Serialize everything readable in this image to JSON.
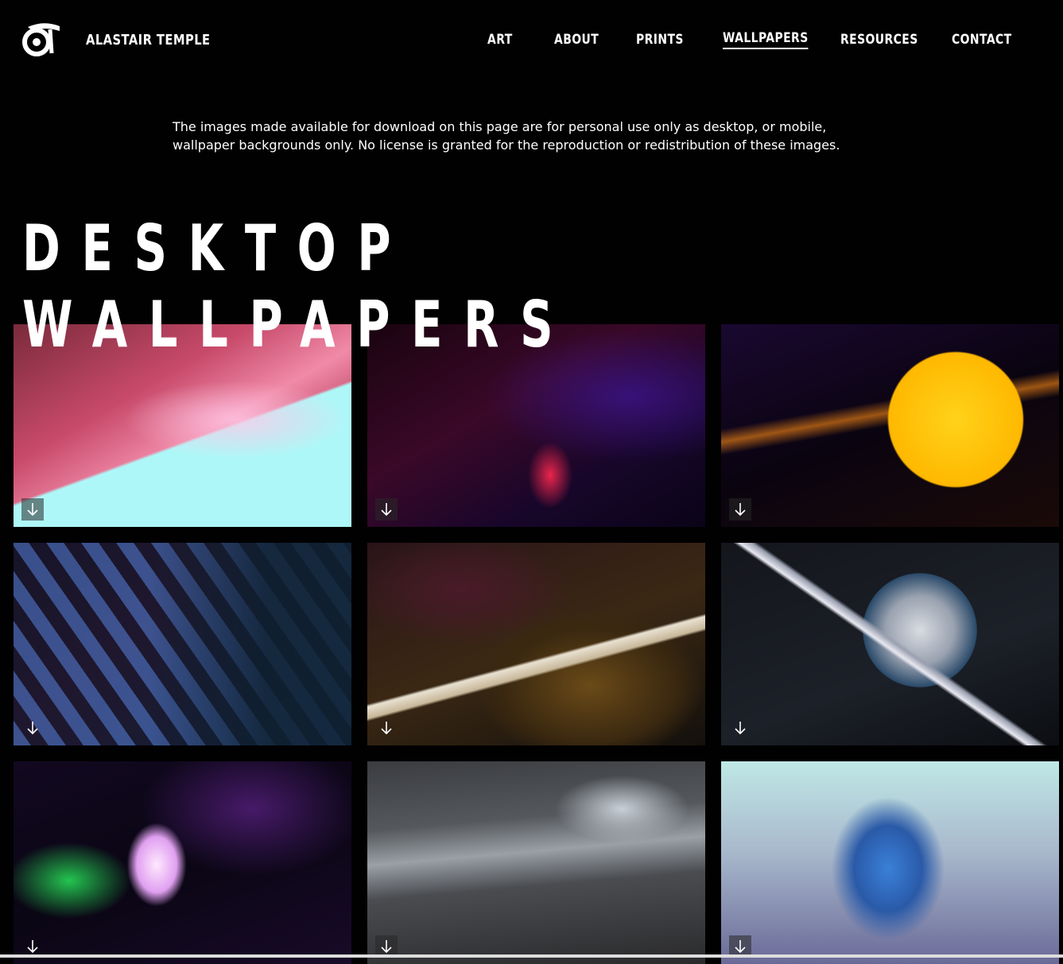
{
  "header": {
    "brand": "ALASTAIR TEMPLE",
    "nav": [
      {
        "label": "ART"
      },
      {
        "label": "ABOUT"
      },
      {
        "label": "PRINTS"
      },
      {
        "label": "WALLPAPERS",
        "active": true
      },
      {
        "label": "RESOURCES"
      },
      {
        "label": "CONTACT"
      }
    ]
  },
  "intro": {
    "text": "The images made available for download on this page are for personal use only as desktop, or mobile, wallpaper backgrounds only. No license is granted for the reproduction or redistribution of these images."
  },
  "heading": {
    "line1": "DESKTOP",
    "line2": "WALLPAPERS"
  },
  "wallpapers": [
    {
      "name": "pink-chrome-abstract",
      "download_icon": "download-arrow-icon"
    },
    {
      "name": "dark-purple-abstract",
      "download_icon": "download-arrow-icon"
    },
    {
      "name": "yellow-planet-streaks",
      "download_icon": "download-arrow-icon"
    },
    {
      "name": "blue-tentacles",
      "download_icon": "download-arrow-icon"
    },
    {
      "name": "asteroid-ship",
      "download_icon": "download-arrow-icon"
    },
    {
      "name": "moon-spaceship",
      "download_icon": "download-arrow-icon"
    },
    {
      "name": "neon-green-glow",
      "download_icon": "download-arrow-icon"
    },
    {
      "name": "rocky-landscape",
      "download_icon": "download-arrow-icon"
    },
    {
      "name": "blue-creature",
      "download_icon": "download-arrow-icon"
    }
  ],
  "colors": {
    "background": "#020102",
    "text": "#ffffff"
  }
}
